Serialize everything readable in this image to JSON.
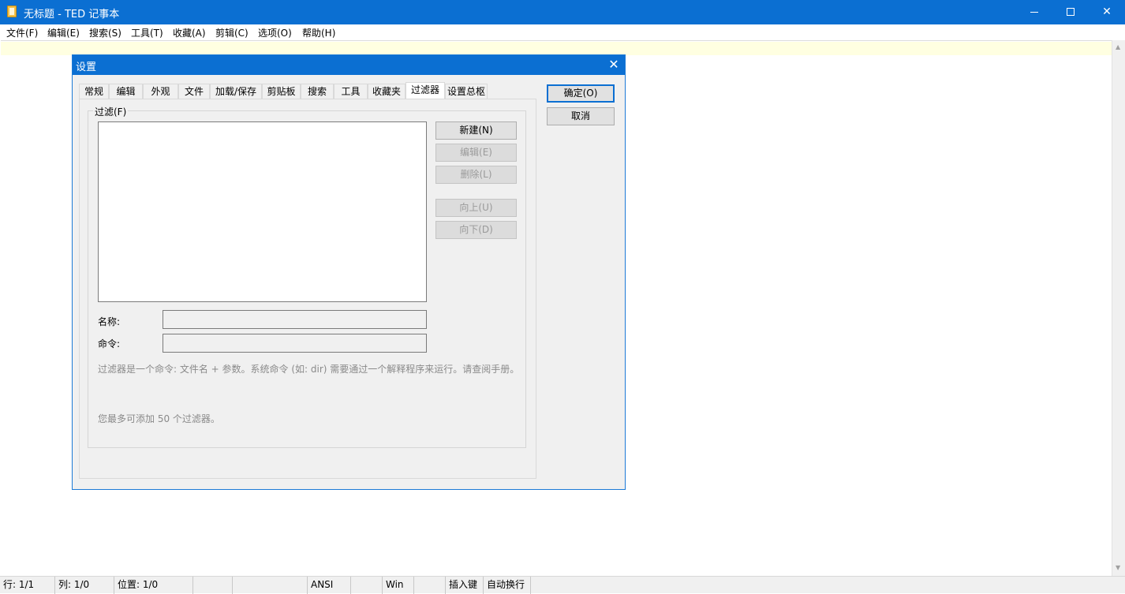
{
  "window": {
    "title": "无标题 - TED 记事本",
    "minimize_glyph": "",
    "maximize_glyph": "",
    "close_glyph": "✕"
  },
  "menu": [
    "文件(F)",
    "编辑(E)",
    "搜索(S)",
    "工具(T)",
    "收藏(A)",
    "剪辑(C)",
    "选项(O)",
    "帮助(H)"
  ],
  "statusbar": {
    "line": "行: 1/1",
    "col": "列: 1/0",
    "pos": "位置: 1/0",
    "encoding": "ANSI",
    "eol": "Win",
    "insert": "插入键",
    "wrap": "自动换行"
  },
  "dialog": {
    "title": "设置",
    "close_glyph": "✕",
    "tabs": [
      "常规",
      "编辑",
      "外观",
      "文件",
      "加载/保存",
      "剪贴板",
      "搜索",
      "工具",
      "收藏夹",
      "过滤器",
      "设置总枢"
    ],
    "active_tab": "过滤器",
    "group_label": "过滤(F)",
    "buttons": {
      "new": "新建(N)",
      "edit": "编辑(E)",
      "delete": "删除(L)",
      "up": "向上(U)",
      "down": "向下(D)",
      "ok": "确定(O)",
      "cancel": "取消"
    },
    "name_label": "名称:",
    "command_label": "命令:",
    "name_value": "",
    "command_value": "",
    "hint1": "过滤器是一个命令: 文件名 + 参数。系统命令 (如: dir) 需要通过一个解释程序来运行。请查阅手册。",
    "hint2": "您最多可添加 50 个过滤器。"
  },
  "colors": {
    "titlebar": "#0b6fd2",
    "current_line": "#ffffe1",
    "dialog_bg": "#f0f0f0"
  }
}
